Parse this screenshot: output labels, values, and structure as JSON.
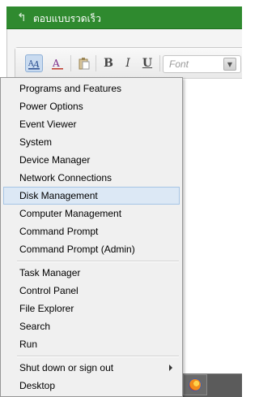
{
  "editor": {
    "title": "ตอบแบบรวดเร็ว",
    "toolbar": {
      "font_placeholder": "Font",
      "bold_label": "B",
      "italic_label": "I",
      "underline_label": "U"
    }
  },
  "menu": {
    "groups": [
      {
        "items": [
          {
            "label": "Programs and Features"
          },
          {
            "label": "Power Options"
          },
          {
            "label": "Event Viewer"
          },
          {
            "label": "System"
          },
          {
            "label": "Device Manager"
          },
          {
            "label": "Network Connections"
          },
          {
            "label": "Disk Management",
            "highlighted": true
          },
          {
            "label": "Computer Management"
          },
          {
            "label": "Command Prompt"
          },
          {
            "label": "Command Prompt (Admin)"
          }
        ]
      },
      {
        "items": [
          {
            "label": "Task Manager"
          },
          {
            "label": "Control Panel"
          },
          {
            "label": "File Explorer"
          },
          {
            "label": "Search"
          },
          {
            "label": "Run"
          }
        ]
      },
      {
        "items": [
          {
            "label": "Shut down or sign out",
            "has_submenu": true
          },
          {
            "label": "Desktop"
          }
        ]
      }
    ]
  },
  "colors": {
    "header_green": "#2f8a2f",
    "menu_highlight": "#dce8f5",
    "menu_highlight_border": "#a6c5e5"
  }
}
